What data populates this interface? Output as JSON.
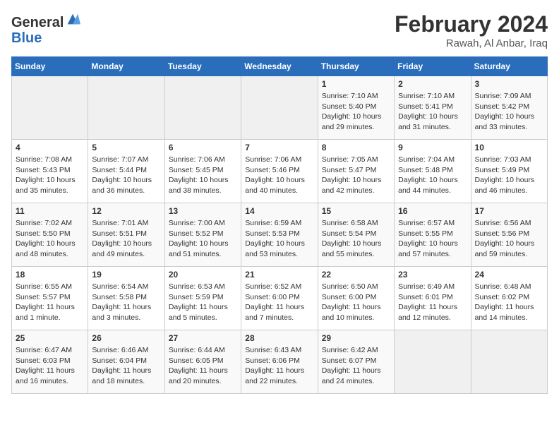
{
  "header": {
    "logo_line1": "General",
    "logo_line2": "Blue",
    "month_year": "February 2024",
    "location": "Rawah, Al Anbar, Iraq"
  },
  "weekdays": [
    "Sunday",
    "Monday",
    "Tuesday",
    "Wednesday",
    "Thursday",
    "Friday",
    "Saturday"
  ],
  "weeks": [
    [
      {
        "day": "",
        "info": ""
      },
      {
        "day": "",
        "info": ""
      },
      {
        "day": "",
        "info": ""
      },
      {
        "day": "",
        "info": ""
      },
      {
        "day": "1",
        "info": "Sunrise: 7:10 AM\nSunset: 5:40 PM\nDaylight: 10 hours\nand 29 minutes."
      },
      {
        "day": "2",
        "info": "Sunrise: 7:10 AM\nSunset: 5:41 PM\nDaylight: 10 hours\nand 31 minutes."
      },
      {
        "day": "3",
        "info": "Sunrise: 7:09 AM\nSunset: 5:42 PM\nDaylight: 10 hours\nand 33 minutes."
      }
    ],
    [
      {
        "day": "4",
        "info": "Sunrise: 7:08 AM\nSunset: 5:43 PM\nDaylight: 10 hours\nand 35 minutes."
      },
      {
        "day": "5",
        "info": "Sunrise: 7:07 AM\nSunset: 5:44 PM\nDaylight: 10 hours\nand 36 minutes."
      },
      {
        "day": "6",
        "info": "Sunrise: 7:06 AM\nSunset: 5:45 PM\nDaylight: 10 hours\nand 38 minutes."
      },
      {
        "day": "7",
        "info": "Sunrise: 7:06 AM\nSunset: 5:46 PM\nDaylight: 10 hours\nand 40 minutes."
      },
      {
        "day": "8",
        "info": "Sunrise: 7:05 AM\nSunset: 5:47 PM\nDaylight: 10 hours\nand 42 minutes."
      },
      {
        "day": "9",
        "info": "Sunrise: 7:04 AM\nSunset: 5:48 PM\nDaylight: 10 hours\nand 44 minutes."
      },
      {
        "day": "10",
        "info": "Sunrise: 7:03 AM\nSunset: 5:49 PM\nDaylight: 10 hours\nand 46 minutes."
      }
    ],
    [
      {
        "day": "11",
        "info": "Sunrise: 7:02 AM\nSunset: 5:50 PM\nDaylight: 10 hours\nand 48 minutes."
      },
      {
        "day": "12",
        "info": "Sunrise: 7:01 AM\nSunset: 5:51 PM\nDaylight: 10 hours\nand 49 minutes."
      },
      {
        "day": "13",
        "info": "Sunrise: 7:00 AM\nSunset: 5:52 PM\nDaylight: 10 hours\nand 51 minutes."
      },
      {
        "day": "14",
        "info": "Sunrise: 6:59 AM\nSunset: 5:53 PM\nDaylight: 10 hours\nand 53 minutes."
      },
      {
        "day": "15",
        "info": "Sunrise: 6:58 AM\nSunset: 5:54 PM\nDaylight: 10 hours\nand 55 minutes."
      },
      {
        "day": "16",
        "info": "Sunrise: 6:57 AM\nSunset: 5:55 PM\nDaylight: 10 hours\nand 57 minutes."
      },
      {
        "day": "17",
        "info": "Sunrise: 6:56 AM\nSunset: 5:56 PM\nDaylight: 10 hours\nand 59 minutes."
      }
    ],
    [
      {
        "day": "18",
        "info": "Sunrise: 6:55 AM\nSunset: 5:57 PM\nDaylight: 11 hours\nand 1 minute."
      },
      {
        "day": "19",
        "info": "Sunrise: 6:54 AM\nSunset: 5:58 PM\nDaylight: 11 hours\nand 3 minutes."
      },
      {
        "day": "20",
        "info": "Sunrise: 6:53 AM\nSunset: 5:59 PM\nDaylight: 11 hours\nand 5 minutes."
      },
      {
        "day": "21",
        "info": "Sunrise: 6:52 AM\nSunset: 6:00 PM\nDaylight: 11 hours\nand 7 minutes."
      },
      {
        "day": "22",
        "info": "Sunrise: 6:50 AM\nSunset: 6:00 PM\nDaylight: 11 hours\nand 10 minutes."
      },
      {
        "day": "23",
        "info": "Sunrise: 6:49 AM\nSunset: 6:01 PM\nDaylight: 11 hours\nand 12 minutes."
      },
      {
        "day": "24",
        "info": "Sunrise: 6:48 AM\nSunset: 6:02 PM\nDaylight: 11 hours\nand 14 minutes."
      }
    ],
    [
      {
        "day": "25",
        "info": "Sunrise: 6:47 AM\nSunset: 6:03 PM\nDaylight: 11 hours\nand 16 minutes."
      },
      {
        "day": "26",
        "info": "Sunrise: 6:46 AM\nSunset: 6:04 PM\nDaylight: 11 hours\nand 18 minutes."
      },
      {
        "day": "27",
        "info": "Sunrise: 6:44 AM\nSunset: 6:05 PM\nDaylight: 11 hours\nand 20 minutes."
      },
      {
        "day": "28",
        "info": "Sunrise: 6:43 AM\nSunset: 6:06 PM\nDaylight: 11 hours\nand 22 minutes."
      },
      {
        "day": "29",
        "info": "Sunrise: 6:42 AM\nSunset: 6:07 PM\nDaylight: 11 hours\nand 24 minutes."
      },
      {
        "day": "",
        "info": ""
      },
      {
        "day": "",
        "info": ""
      }
    ]
  ]
}
